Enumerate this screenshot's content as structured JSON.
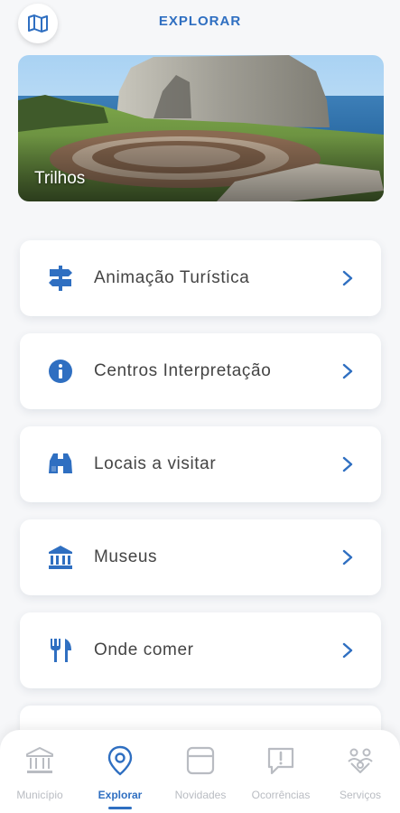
{
  "header": {
    "title": "EXPLORAR",
    "map_icon": "map-icon"
  },
  "hero": {
    "label": "Trilhos"
  },
  "menu": [
    {
      "label": "Animação Turística",
      "icon": "signpost-icon"
    },
    {
      "label": "Centros Interpretação",
      "icon": "info-icon"
    },
    {
      "label": "Locais a visitar",
      "icon": "binoculars-icon"
    },
    {
      "label": "Museus",
      "icon": "museum-icon"
    },
    {
      "label": "Onde comer",
      "icon": "utensils-icon"
    }
  ],
  "tabs": [
    {
      "label": "Município",
      "icon": "building-icon",
      "active": false
    },
    {
      "label": "Explorar",
      "icon": "location-pin-icon",
      "active": true
    },
    {
      "label": "Novidades",
      "icon": "news-icon",
      "active": false
    },
    {
      "label": "Ocorrências",
      "icon": "alert-chat-icon",
      "active": false
    },
    {
      "label": "Serviços",
      "icon": "services-icon",
      "active": false
    }
  ],
  "colors": {
    "accent": "#2f6fc1",
    "inactive": "#b9bcc2",
    "background": "#f6f7f9"
  }
}
